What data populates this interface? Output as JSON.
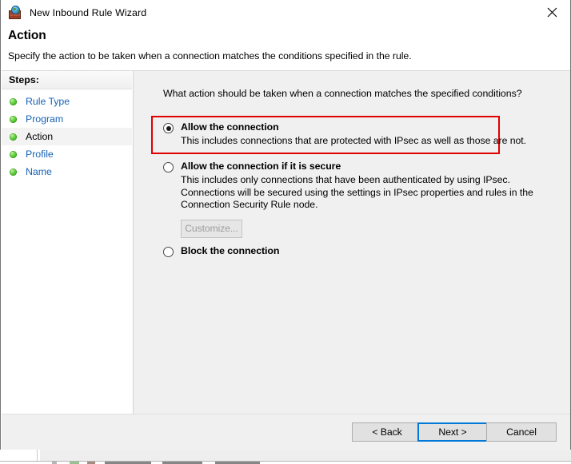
{
  "window": {
    "title": "New Inbound Rule Wizard",
    "icon": "firewall-globe-icon",
    "close_label": "✕"
  },
  "header": {
    "title": "Action",
    "subtitle": "Specify the action to be taken when a connection matches the conditions specified in the rule."
  },
  "sidebar": {
    "header": "Steps:",
    "items": [
      {
        "label": "Rule Type",
        "state": "completed"
      },
      {
        "label": "Program",
        "state": "completed"
      },
      {
        "label": "Action",
        "state": "current"
      },
      {
        "label": "Profile",
        "state": "completed"
      },
      {
        "label": "Name",
        "state": "completed"
      }
    ]
  },
  "main": {
    "question": "What action should be taken when a connection matches the specified conditions?",
    "options": [
      {
        "id": "allow",
        "title": "Allow the connection",
        "description": "This includes connections that are protected with IPsec as well as those are not.",
        "selected": true,
        "highlighted": true
      },
      {
        "id": "allow-if-secure",
        "title": "Allow the connection if it is secure",
        "description": "This includes only connections that have been authenticated by using IPsec.  Connections will be secured using the settings in IPsec properties and rules in the Connection Security Rule node.",
        "selected": false,
        "highlighted": false,
        "button": {
          "label": "Customize...",
          "enabled": false
        }
      },
      {
        "id": "block",
        "title": "Block the connection",
        "description": "",
        "selected": false,
        "highlighted": false
      }
    ]
  },
  "footer": {
    "back_label": "< Back",
    "next_label": "Next >",
    "cancel_label": "Cancel",
    "default_button": "next"
  },
  "colors": {
    "highlight_border": "#e00000",
    "focus_border": "#0078d7",
    "link_text": "#1763b6",
    "step_bullet": "#62cf3d",
    "content_background": "#f0f0f0",
    "window_background": "#ffffff"
  }
}
